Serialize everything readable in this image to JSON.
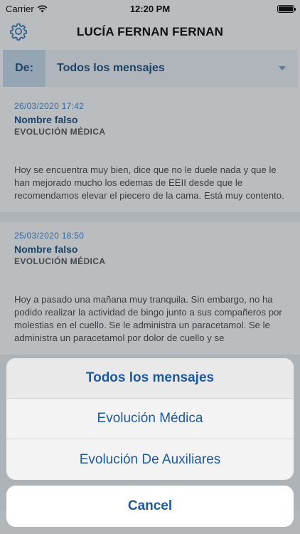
{
  "status_bar": {
    "carrier": "Carrier",
    "time": "12:20 PM"
  },
  "header": {
    "title": "LUCÍA FERNAN FERNAN"
  },
  "filter": {
    "label": "De:",
    "value": "Todos los mensajes"
  },
  "messages": [
    {
      "date": "26/03/2020 17:42",
      "author": "Nombre falso",
      "type": "EVOLUCIÓN MÉDICA",
      "body": "Hoy se encuentra muy bien, dice que no le duele nada y que le han mejorado mucho los edemas de EEII desde que le recomendamos elevar el piecero de la cama. Está muy contento."
    },
    {
      "date": "25/03/2020 18:50",
      "author": "Nombre falso",
      "type": "EVOLUCIÓN MÉDICA",
      "body": "Hoy a pasado una mañana muy tranquila. Sin embargo, no ha podido realizar la actividad de bingo junto a sus compañeros por molestias en el cuello. Se le administra un paracetamol. Se le administra un paracetamol por dolor de cuello y se"
    }
  ],
  "action_sheet": {
    "options": [
      "Todos los mensajes",
      "Evolución Médica",
      "Evolución De Auxiliares"
    ],
    "cancel": "Cancel"
  },
  "colors": {
    "accent": "#1d5aa0",
    "date": "#3b82c4",
    "header_text": "#1a4a7a"
  }
}
